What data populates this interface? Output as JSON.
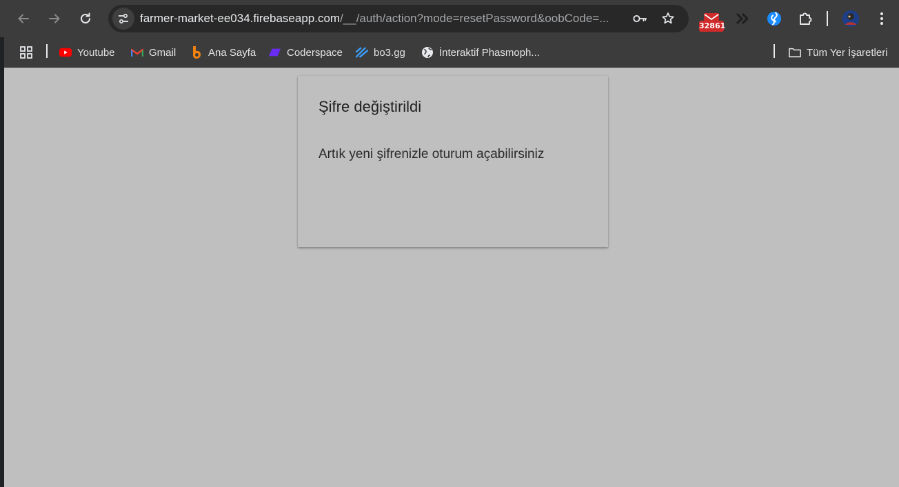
{
  "browser": {
    "url_host": "farmer-market-ee034.firebaseapp.com",
    "url_path": "/__/auth/action?mode=resetPassword&oobCode=...",
    "extensions": [
      {
        "name": "mail-extension",
        "badge": "32861"
      },
      {
        "name": "fast-forward-extension"
      },
      {
        "name": "shazam-extension"
      },
      {
        "name": "extensions-puzzle"
      }
    ]
  },
  "bookmarks": {
    "items": [
      {
        "label": "Youtube",
        "icon": "youtube-icon"
      },
      {
        "label": "Gmail",
        "icon": "gmail-icon"
      },
      {
        "label": "Ana Sayfa",
        "icon": "ana-sayfa-icon"
      },
      {
        "label": "Coderspace",
        "icon": "coderspace-icon"
      },
      {
        "label": "bo3.gg",
        "icon": "bo3-icon"
      },
      {
        "label": "İnteraktif Phasmoph...",
        "icon": "globe-icon"
      }
    ],
    "all_bookmarks": "Tüm Yer İşaretleri"
  },
  "card": {
    "title": "Şifre değiştirildi",
    "message": "Artık yeni şifrenizle oturum açabilirsiniz"
  },
  "colors": {
    "page_background": "#bfbfbf",
    "toolbar": "#3c3c3c",
    "omnibox": "#282828",
    "badge": "#d02b2b"
  }
}
